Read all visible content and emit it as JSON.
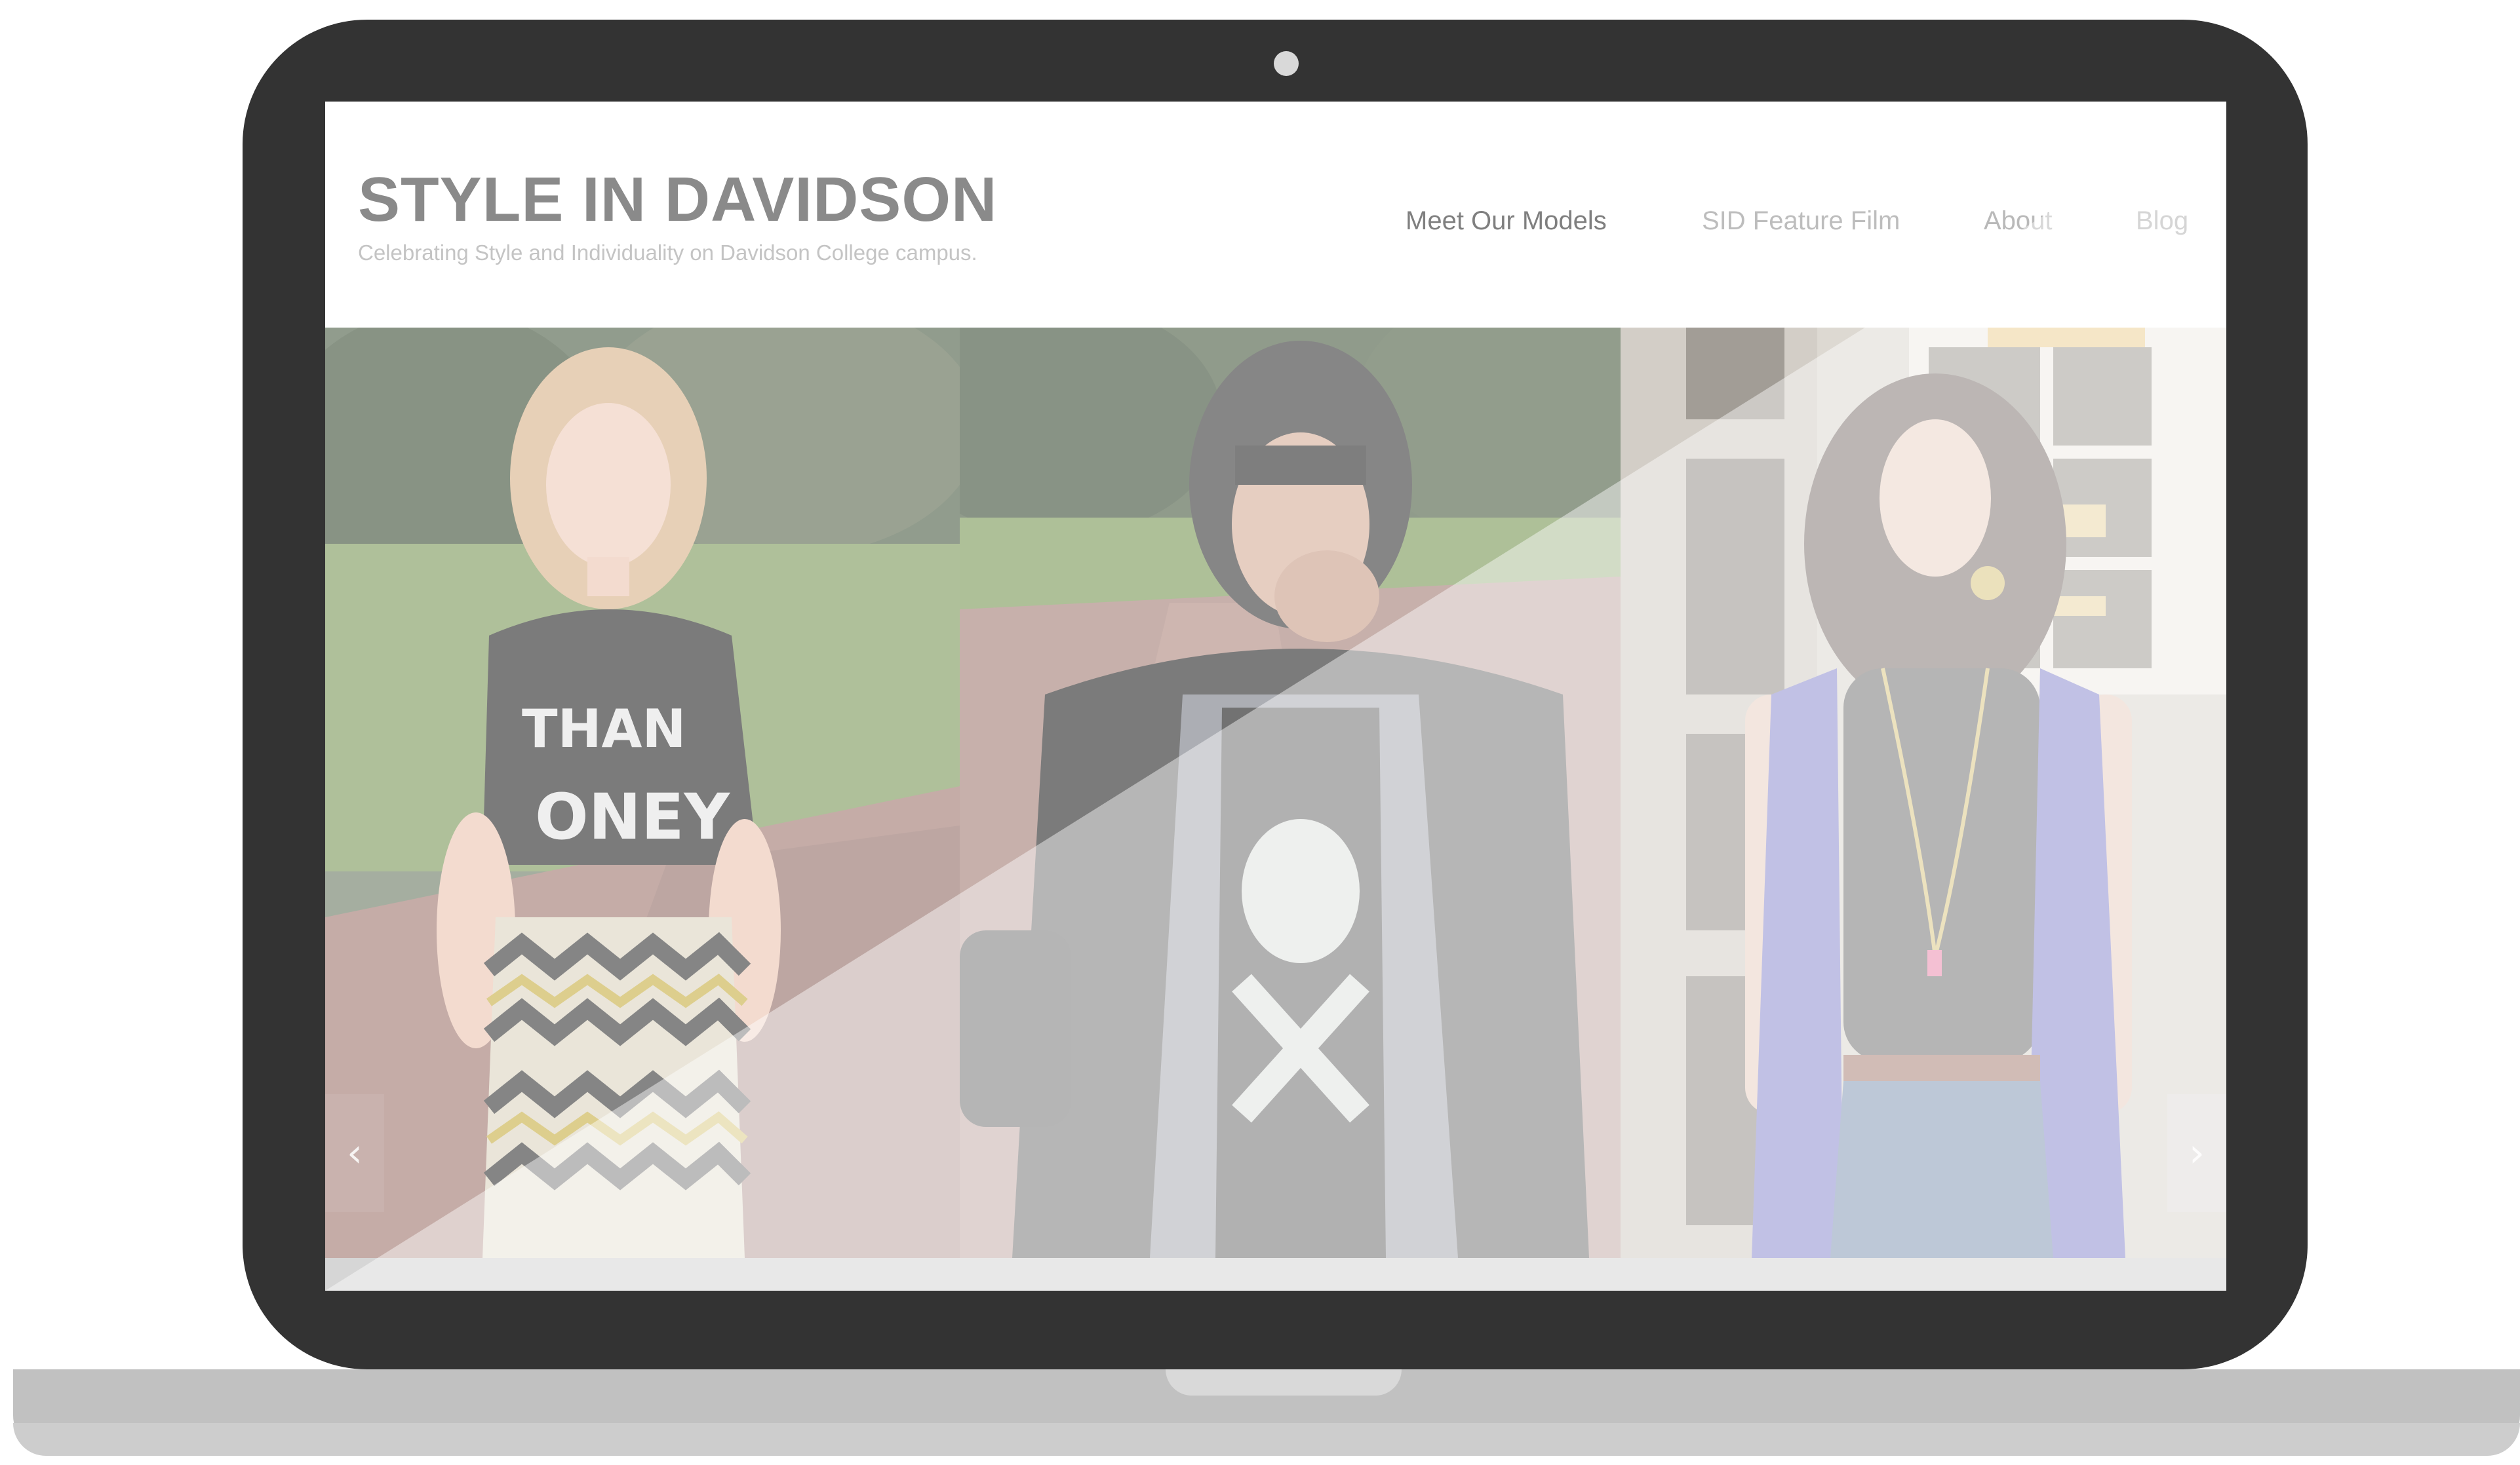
{
  "site": {
    "title": "STYLE IN DAVIDSON",
    "tagline": "Celebrating Style and Individuality on Davidson College campus."
  },
  "nav": {
    "items": [
      {
        "label": "Meet Our Models"
      },
      {
        "label": "SID Feature Film"
      },
      {
        "label": "About"
      },
      {
        "label": "Blog"
      }
    ]
  },
  "gallery": {
    "prev_icon": "chevron-left-icon",
    "next_icon": "chevron-right-icon",
    "prev_glyph": "‹",
    "next_glyph": "›"
  },
  "colors": {
    "bezel": "#333333",
    "title": "#8a8a8a",
    "tagline": "#c4c4c4",
    "base": "#c1c1c1"
  }
}
